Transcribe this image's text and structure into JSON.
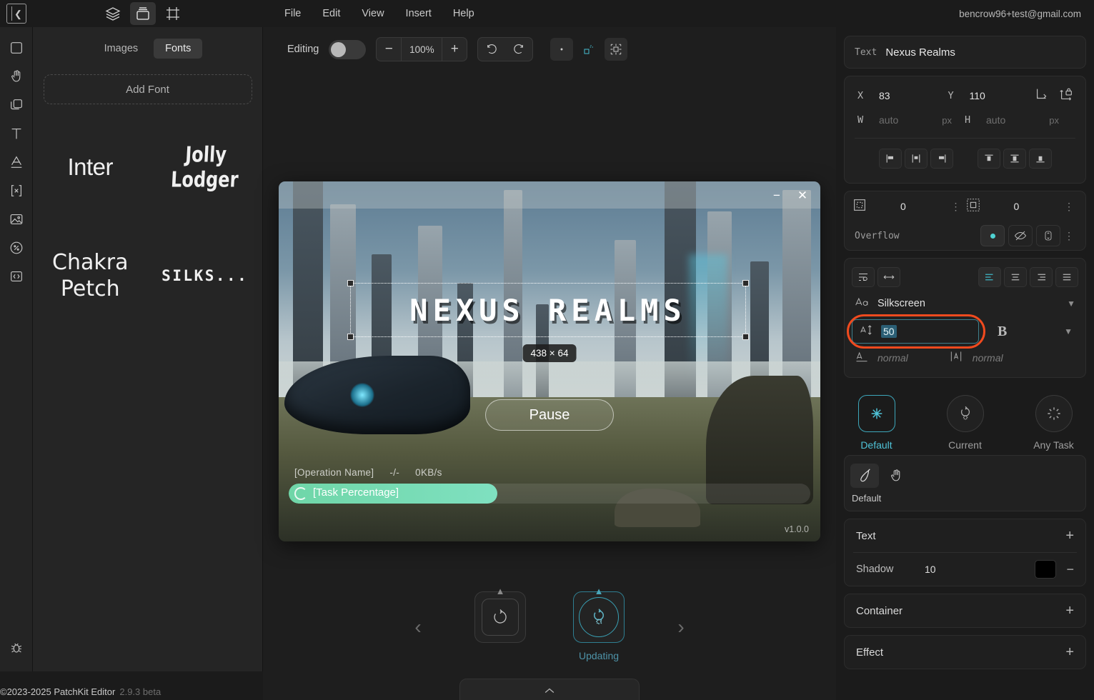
{
  "topbar": {
    "collapse_icon": "panel-collapse-icon",
    "icons": [
      {
        "name": "layers-icon",
        "active": false
      },
      {
        "name": "assets-folder-icon",
        "active": true
      },
      {
        "name": "frame-icon",
        "active": false
      }
    ],
    "menus": [
      "File",
      "Edit",
      "View",
      "Insert",
      "Help"
    ],
    "account_email": "bencrow96+test@gmail.com"
  },
  "rail": {
    "items": [
      {
        "name": "rectangle-tool-icon"
      },
      {
        "name": "pointer-hand-tool-icon"
      },
      {
        "name": "duplicate-tool-icon"
      },
      {
        "name": "text-tool-icon"
      },
      {
        "name": "font-tool-icon"
      },
      {
        "name": "button-tool-icon"
      },
      {
        "name": "image-tool-icon"
      },
      {
        "name": "percent-tool-icon"
      },
      {
        "name": "code-tool-icon"
      }
    ],
    "bottom": {
      "name": "bug-report-icon"
    }
  },
  "assets": {
    "tabs": [
      {
        "label": "Images",
        "active": false
      },
      {
        "label": "Fonts",
        "active": true
      }
    ],
    "add_font_label": "Add Font",
    "fonts": [
      "Inter",
      "Jolly Lodger",
      "Chakra Petch",
      "SILKS..."
    ]
  },
  "canvas_toolbar": {
    "editing_label": "Editing",
    "editing_on": false,
    "zoom_out": "−",
    "zoom_value": "100%",
    "zoom_in": "+",
    "undo": "undo-icon",
    "redo": "redo-icon",
    "snap_point": "snap-point-icon",
    "snap_object": "snap-object-icon",
    "snap_grid": "snap-grid-icon"
  },
  "game_window": {
    "minimize": "−",
    "close": "✕",
    "title_text": "NEXUS REALMS",
    "size_badge": "438 × 64",
    "pause_label": "Pause",
    "operation_name": "[Operation Name]",
    "operation_progress": "-/-",
    "operation_speed": "0KB/s",
    "task_percentage_label": "[Task Percentage]",
    "version": "v1.0.0"
  },
  "carousel": {
    "prev": "‹",
    "next": "›",
    "cards": [
      {
        "icon": "refresh-icon",
        "label": "",
        "selected": false
      },
      {
        "icon": "updating-icon",
        "label": "Updating",
        "selected": true
      }
    ],
    "drawer_handle": "chevron-up-icon"
  },
  "props": {
    "element": {
      "type_label": "Text",
      "name": "Nexus Realms"
    },
    "transform": {
      "x_key": "X",
      "x_value": "83",
      "y_key": "Y",
      "y_value": "110",
      "w_key": "W",
      "w_value": "auto",
      "w_unit": "px",
      "h_key": "H",
      "h_value": "auto",
      "h_unit": "px",
      "anchor_icon": "anchor-corner-icon",
      "lock_icon": "aspect-lock-icon"
    },
    "align": {
      "horizontal": [
        "align-left-icon",
        "align-center-icon",
        "align-right-icon"
      ],
      "vertical": [
        "align-top-icon",
        "align-middle-icon",
        "align-bottom-icon"
      ]
    },
    "spacing": {
      "padding_icon": "padding-icon",
      "padding_value": "0",
      "margin_icon": "margin-icon",
      "margin_value": "0",
      "overflow_label": "Overflow"
    },
    "text": {
      "wrap_icon": "text-wrap-icon",
      "nowrap_icon": "text-nowrap-icon",
      "align_options": [
        "text-align-left-icon",
        "text-align-center-icon",
        "text-align-right-icon",
        "text-align-justify-icon"
      ],
      "font_family_icon": "font-family-icon",
      "font_family": "Silkscreen",
      "font_size_icon": "font-size-icon",
      "font_size": "50",
      "bold_label": "B",
      "line_height_icon": "line-height-icon",
      "line_height": "normal",
      "letter_spacing_icon": "letter-spacing-icon",
      "letter_spacing": "normal"
    },
    "states": [
      {
        "label": "Default",
        "icon": "asterisk-icon",
        "active": true
      },
      {
        "label": "Current",
        "icon": "current-task-icon",
        "active": false
      },
      {
        "label": "Any Task",
        "icon": "any-task-icon",
        "active": false
      }
    ],
    "style_tools": {
      "brush_icon": "brush-icon",
      "hand_icon": "hand-icon",
      "caption": "Default"
    },
    "sections": [
      {
        "title": "Text",
        "action": "+",
        "sub": {
          "label": "Shadow",
          "value": "10",
          "color": "#000000",
          "action": "−"
        }
      },
      {
        "title": "Container",
        "action": "+"
      },
      {
        "title": "Effect",
        "action": "+"
      }
    ]
  },
  "footer": {
    "copyright": "©2023-2025 PatchKit Editor",
    "version": "2.9.3 beta"
  },
  "colors": {
    "accent_cyan": "#4fc3d8",
    "annotation_red": "#f04a1e",
    "progress_green": "#6fd6a8"
  }
}
